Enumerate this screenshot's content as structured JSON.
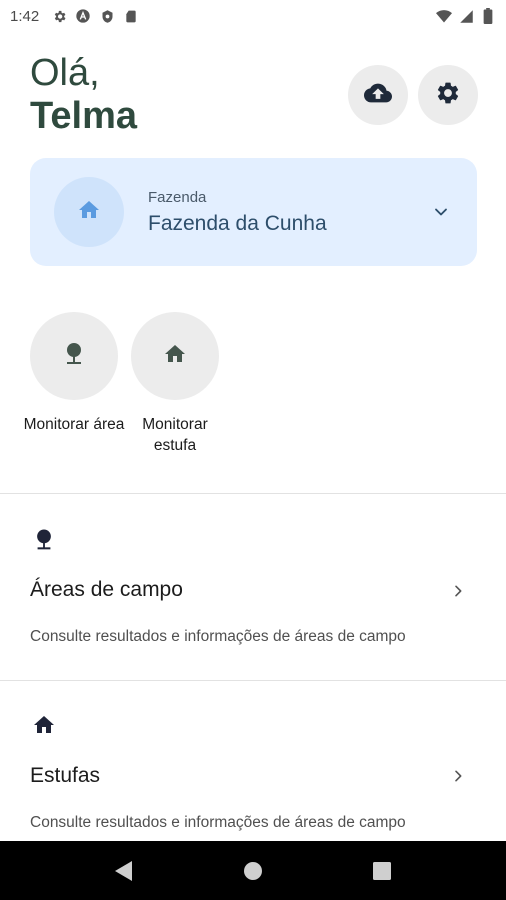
{
  "status_bar": {
    "time": "1:42",
    "icons_left": [
      "gear-icon",
      "a-icon",
      "shield-icon",
      "sd-card-icon"
    ],
    "icons_right": [
      "wifi-icon",
      "signal-icon",
      "battery-icon"
    ]
  },
  "header": {
    "greeting": "Olá,",
    "user_name": "Telma",
    "actions": [
      "cloud-upload-icon",
      "settings-icon"
    ]
  },
  "farm_selector": {
    "label": "Fazenda",
    "value": "Fazenda da Cunha",
    "icon": "home-icon"
  },
  "quick_actions": [
    {
      "label": "Monitorar área",
      "icon": "tree-icon"
    },
    {
      "label": "Monitorar estufa",
      "icon": "home-icon"
    }
  ],
  "sections": [
    {
      "title": "Áreas de campo",
      "description": "Consulte resultados e informações de áreas de campo",
      "icon": "tree-icon"
    },
    {
      "title": "Estufas",
      "description": "Consulte resultados e informações de áreas de campo",
      "icon": "home-icon"
    }
  ],
  "nav_bar": [
    "back-icon",
    "home-circle-icon",
    "recents-icon"
  ],
  "colors": {
    "primary_dark": "#2f4a3e",
    "card_bg": "#e3efff",
    "accent_blue": "#4a90d9",
    "circle_bg": "#ececec"
  }
}
